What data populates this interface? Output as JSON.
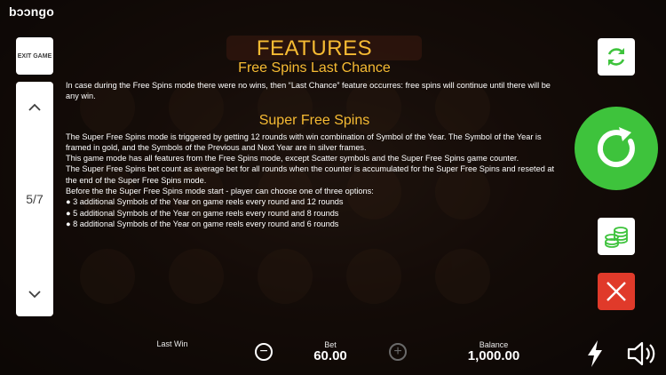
{
  "brand": {
    "logo": "bɔɔngo"
  },
  "nav": {
    "exit_label": "EXIT GAME",
    "page_indicator": "5/7",
    "up_icon": "chevron-up-icon",
    "down_icon": "chevron-down-icon"
  },
  "rules": {
    "title": "FEATURES",
    "sections": [
      {
        "heading": "Free Spins Last Chance",
        "lines": [
          "In case during the Free Spins mode there were no wins, then “Last Chance” feature occurres: free spins will continue until there will be any win."
        ]
      },
      {
        "heading": "Super Free Spins",
        "lines": [
          "The Super Free Spins mode is triggered by getting 12 rounds with win combination of Symbol of the Year. The Symbol of the Year is framed in gold, and the Symbols of the Previous and Next Year are in silver frames.",
          "This game mode has all features from the Free Spins mode, except Scatter symbols and the Super Free Spins game counter.",
          "The Super Free Spins bet count as average bet for all rounds when the counter is accumulated for the Super Free Spins and reseted at the end of the Super Free Spins mode.",
          "Before the the Super Free Spins mode start - player can choose one of three options:",
          "● 3 additional Symbols of the Year on game reels every round and 12 rounds",
          "● 5 additional Symbols of the Year on game reels every round and 8 rounds",
          "● 8 additional Symbols of the Year on game reels every round and 6 rounds"
        ]
      }
    ]
  },
  "controls": {
    "last_win_label": "Last Win",
    "last_win_value": "",
    "bet_label": "Bet",
    "bet_value": "60.00",
    "balance_label": "Balance",
    "balance_value": "1,000.00",
    "minus_symbol": "−",
    "plus_symbol": "+"
  },
  "colors": {
    "heading": "#f6bb33",
    "spin_button": "#3ec33c",
    "close_button": "#e03a2a"
  }
}
